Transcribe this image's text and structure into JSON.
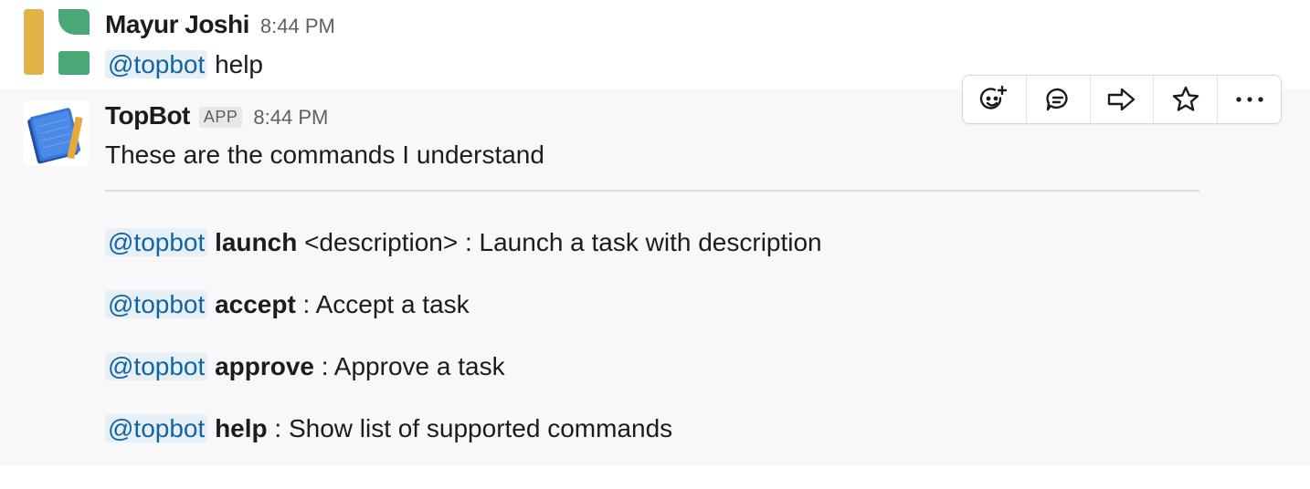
{
  "messages": [
    {
      "author": "Mayur Joshi",
      "time": "8:44 PM",
      "mention": "@topbot",
      "text": "help"
    },
    {
      "author": "TopBot",
      "badge": "APP",
      "time": "8:44 PM",
      "intro": "These are the commands I understand",
      "commands": [
        {
          "mention": "@topbot",
          "name": "launch",
          "desc": " <description> : Launch a task with description"
        },
        {
          "mention": "@topbot",
          "name": "accept",
          "desc": " : Accept a task"
        },
        {
          "mention": "@topbot",
          "name": "approve",
          "desc": " : Approve a task"
        },
        {
          "mention": "@topbot",
          "name": "help",
          "desc": " : Show list of supported commands"
        }
      ]
    }
  ],
  "toolbar": {
    "actions": [
      "add-reaction-icon",
      "reply-thread-icon",
      "share-message-icon",
      "star-icon",
      "more-actions-icon"
    ]
  },
  "colors": {
    "mention_text": "#1264a3",
    "mention_bg": "#e8f0f7",
    "hover_bg": "#f8f8f8"
  }
}
